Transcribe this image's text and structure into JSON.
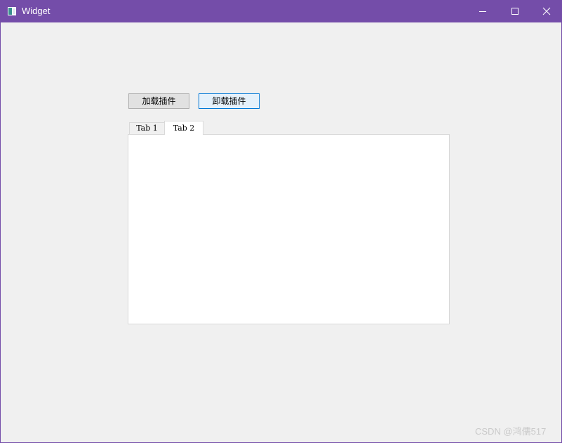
{
  "window": {
    "title": "Widget",
    "accent_color": "#744da9",
    "controls": {
      "minimize_icon": "minimize-icon",
      "maximize_icon": "maximize-icon",
      "close_icon": "close-icon"
    }
  },
  "toolbar": {
    "load_label": "加载插件",
    "unload_label": "卸载插件"
  },
  "tabs": [
    {
      "label": "Tab 1",
      "selected": false
    },
    {
      "label": "Tab 2",
      "selected": true
    }
  ],
  "watermark": "CSDN @鸿儒517"
}
